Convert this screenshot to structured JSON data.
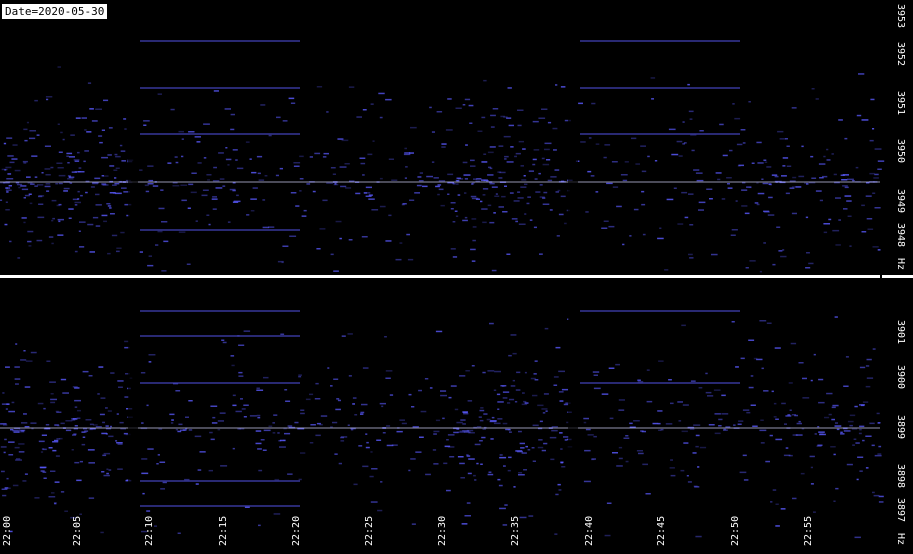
{
  "date_label": "Date=2020-05-30",
  "top_panel": {
    "y_labels": [
      "3953",
      "3952",
      "3951",
      "3950",
      "3949",
      "3948",
      "Hz"
    ]
  },
  "bottom_panel": {
    "y_labels": [
      "3901",
      "3900",
      "3899",
      "3898",
      "3897",
      "Hz"
    ]
  },
  "x_labels": [
    "22:00",
    "22:05",
    "22:10",
    "22:15",
    "22:20",
    "22:25",
    "22:30",
    "22:35",
    "22:40",
    "22:45",
    "22:50",
    "22:55"
  ],
  "colors": {
    "background": "#000000",
    "signal": "#5a5aff",
    "hot": "#d8d8ff",
    "divider": "#ffffff"
  }
}
